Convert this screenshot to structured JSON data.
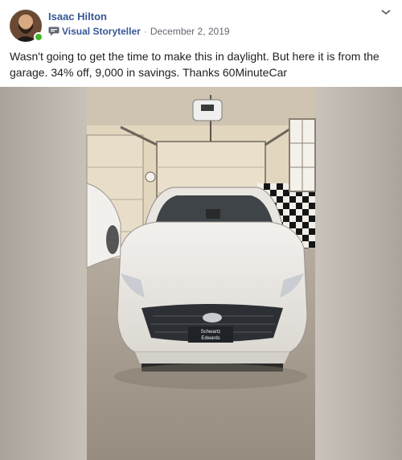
{
  "post": {
    "author_name": "Isaac Hilton",
    "badge_label": "Visual Storyteller",
    "separator": "·",
    "date": "December 2, 2019",
    "text": "Wasn't going to get the time to make this in daylight. But here it is from the garage. 34% off, 9,000 in savings. Thanks 60MinuteCar"
  },
  "media": {
    "plate_line1": "Schwartz",
    "plate_line2": "Edwards"
  },
  "icons": {
    "more": "more-icon",
    "badge": "storyteller-badge-icon"
  },
  "colors": {
    "author": "#385898",
    "online": "#42b72a",
    "meta": "#616770"
  }
}
